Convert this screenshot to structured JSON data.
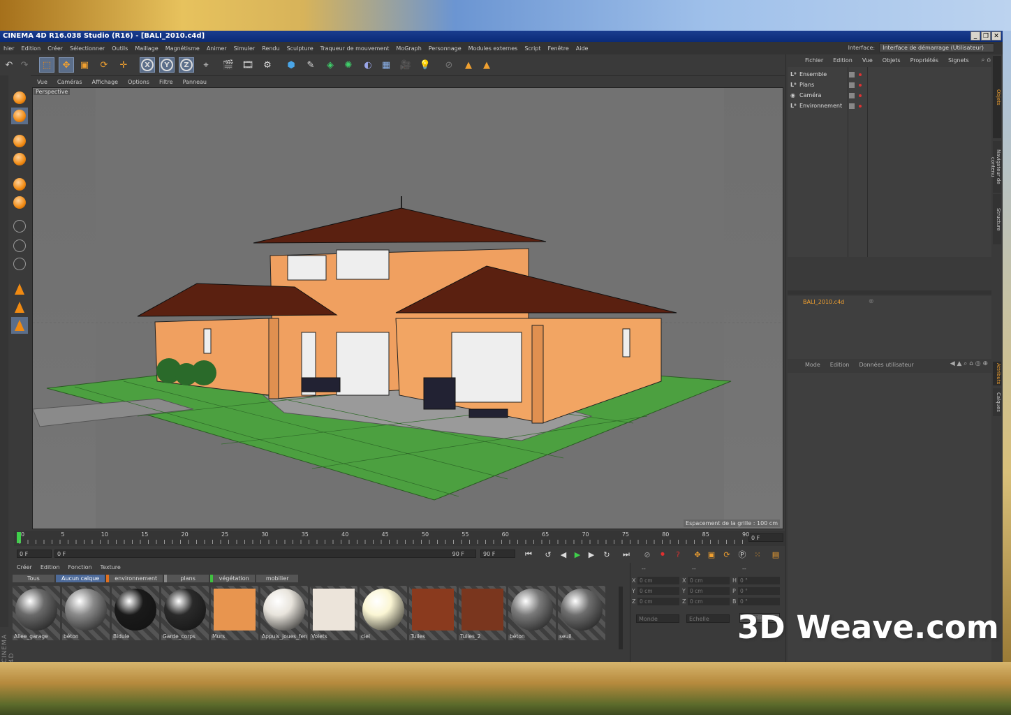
{
  "window": {
    "title": "CINEMA 4D R16.038 Studio (R16) - [BALI_2010.c4d]",
    "controls": [
      "_",
      "❐",
      "✕"
    ]
  },
  "menubar": {
    "items": [
      "hier",
      "Edition",
      "Créer",
      "Sélectionner",
      "Outils",
      "Maillage",
      "Magnétisme",
      "Animer",
      "Simuler",
      "Rendu",
      "Sculpture",
      "Traqueur de mouvement",
      "MoGraph",
      "Personnage",
      "Modules externes",
      "Script",
      "Fenêtre",
      "Aide"
    ],
    "interface_label": "Interface:",
    "interface_value": "Interface de démarrage (Utilisateur)"
  },
  "toolbar": {
    "axis_buttons": [
      "X",
      "Y",
      "Z"
    ]
  },
  "viewport": {
    "menu": [
      "Vue",
      "Caméras",
      "Affichage",
      "Options",
      "Filtre",
      "Panneau"
    ],
    "label": "Perspective",
    "grid_info": "Espacement de la grille : 100 cm"
  },
  "timeline": {
    "ticks": [
      "0",
      "5",
      "10",
      "15",
      "20",
      "25",
      "30",
      "35",
      "40",
      "45",
      "50",
      "55",
      "60",
      "65",
      "70",
      "75",
      "80",
      "85",
      "90"
    ],
    "current_frame": "0 F"
  },
  "playbar": {
    "start": "0 F",
    "slider_left": "0 F",
    "slider_right": "90 F",
    "end": "90 F"
  },
  "materials": {
    "menu": [
      "Créer",
      "Edition",
      "Fonction",
      "Texture"
    ],
    "layers": [
      {
        "label": "Tous",
        "active": false,
        "color": ""
      },
      {
        "label": "Aucun calque",
        "active": true,
        "color": ""
      },
      {
        "label": "environnement",
        "active": false,
        "color": "#e07020"
      },
      {
        "label": "plans",
        "active": false,
        "color": "#888888"
      },
      {
        "label": "végétation",
        "active": false,
        "color": "#40c040"
      },
      {
        "label": "mobilier",
        "active": false,
        "color": ""
      }
    ],
    "swatches": [
      {
        "name": "Allee_garage",
        "kind": "ball",
        "color": "#6a6a6a"
      },
      {
        "name": "béton",
        "kind": "ball",
        "color": "#8a8a8a"
      },
      {
        "name": "Bidule",
        "kind": "ball",
        "color": "#1a1a1a"
      },
      {
        "name": "Garde_corps",
        "kind": "ball",
        "color": "#2a2a2a"
      },
      {
        "name": "Murs",
        "kind": "square",
        "color": "#e8954f"
      },
      {
        "name": "Appuis_joues_fen",
        "kind": "ball",
        "color": "#e8e4dc"
      },
      {
        "name": "Volets",
        "kind": "square",
        "color": "#ece4da"
      },
      {
        "name": "ciel",
        "kind": "ball",
        "color": "#fbf6d4"
      },
      {
        "name": "Tuiles",
        "kind": "square",
        "color": "#8a3a1e"
      },
      {
        "name": "Tuiles_2",
        "kind": "square",
        "color": "#7a361e"
      },
      {
        "name": "béton",
        "kind": "ball",
        "color": "#7a7a7a"
      },
      {
        "name": "seuil",
        "kind": "ball",
        "color": "#6e6e6e"
      }
    ]
  },
  "coordinates": {
    "header": [
      "--",
      "--",
      "--"
    ],
    "rows": [
      {
        "a": "X",
        "av": "0 cm",
        "b": "X",
        "bv": "0 cm",
        "c": "H",
        "cv": "0 °"
      },
      {
        "a": "Y",
        "av": "0 cm",
        "b": "Y",
        "bv": "0 cm",
        "c": "P",
        "cv": "0 °"
      },
      {
        "a": "Z",
        "av": "0 cm",
        "b": "Z",
        "bv": "0 cm",
        "c": "B",
        "cv": "0 °"
      }
    ],
    "mode_select": "Monde",
    "scale_select": "Echelle",
    "apply": "Appliquer"
  },
  "objects": {
    "menu": [
      "Fichier",
      "Edition",
      "Vue",
      "Objets",
      "Propriétés",
      "Signets"
    ],
    "items": [
      "Ensemble",
      "Plans",
      "Caméra",
      "Environnement"
    ],
    "side_tabs": [
      "Objets",
      "Navigateur de contenu",
      "Structure"
    ]
  },
  "takes": {
    "doc_tab": "BALI_2010.c4d"
  },
  "attributes": {
    "menu": [
      "Mode",
      "Edition",
      "Données utilisateur"
    ],
    "side_tabs": [
      "Attributs",
      "Calques"
    ]
  },
  "watermark": "3D Weave.com",
  "side_logo": "CINEMA 4D",
  "colors": {
    "accent_orange": "#f08a12",
    "highlight": "#5b6e8a",
    "wall": "#f0a060",
    "roof": "#5a2010",
    "grass": "#4ca040"
  }
}
